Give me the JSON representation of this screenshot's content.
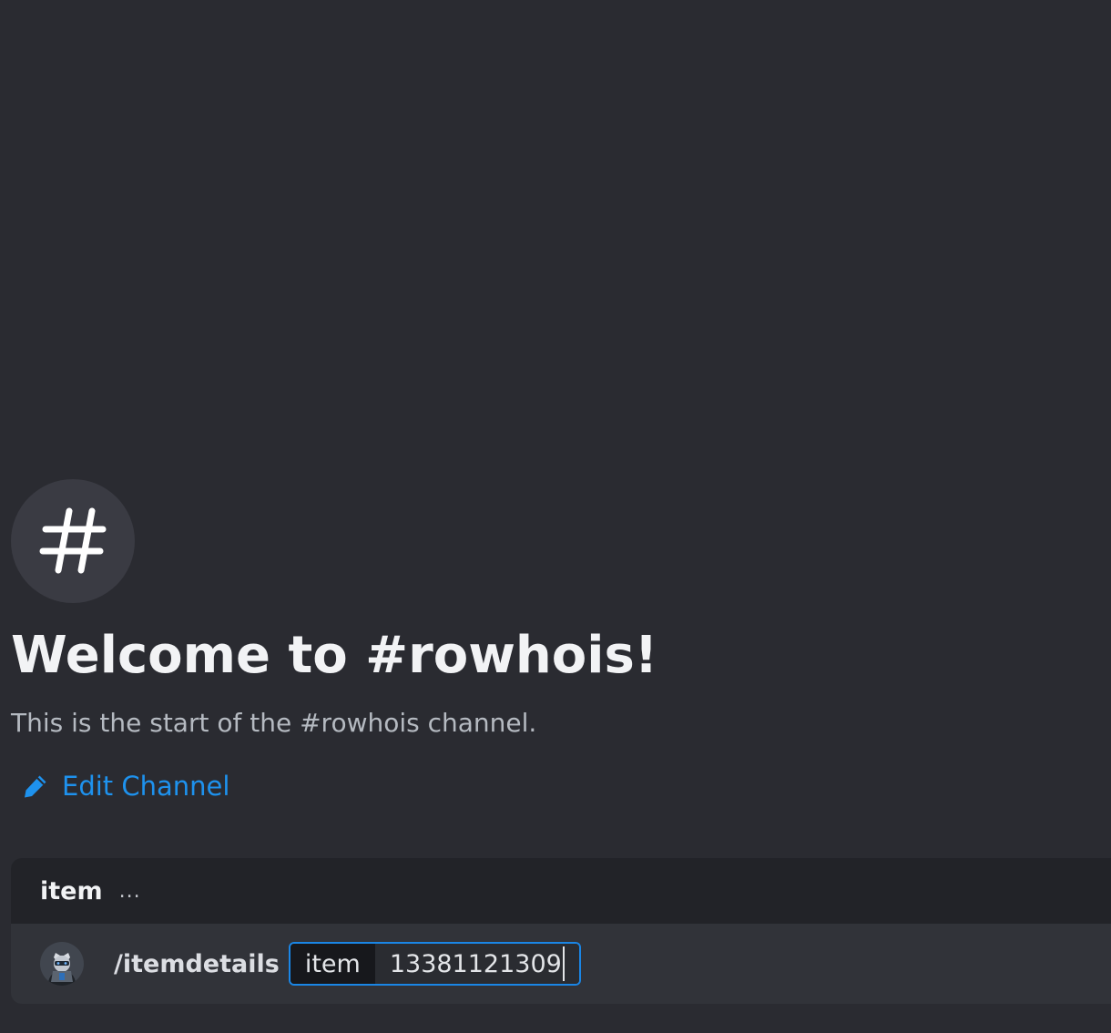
{
  "welcome": {
    "icon": "hashtag-icon",
    "title": "Welcome to #rowhois!",
    "subtitle": "This is the start of the #rowhois channel.",
    "edit_label": "Edit Channel",
    "edit_icon": "pencil-icon"
  },
  "command_panel": {
    "header_title": "item",
    "header_ellipsis": "...",
    "command": "/itemdetails",
    "option_name": "item",
    "option_value": "13381121309",
    "avatar_icon": "bot-avatar"
  },
  "colors": {
    "background": "#2a2b31",
    "link": "#1e92ee",
    "focus_border": "#1a86e6"
  }
}
